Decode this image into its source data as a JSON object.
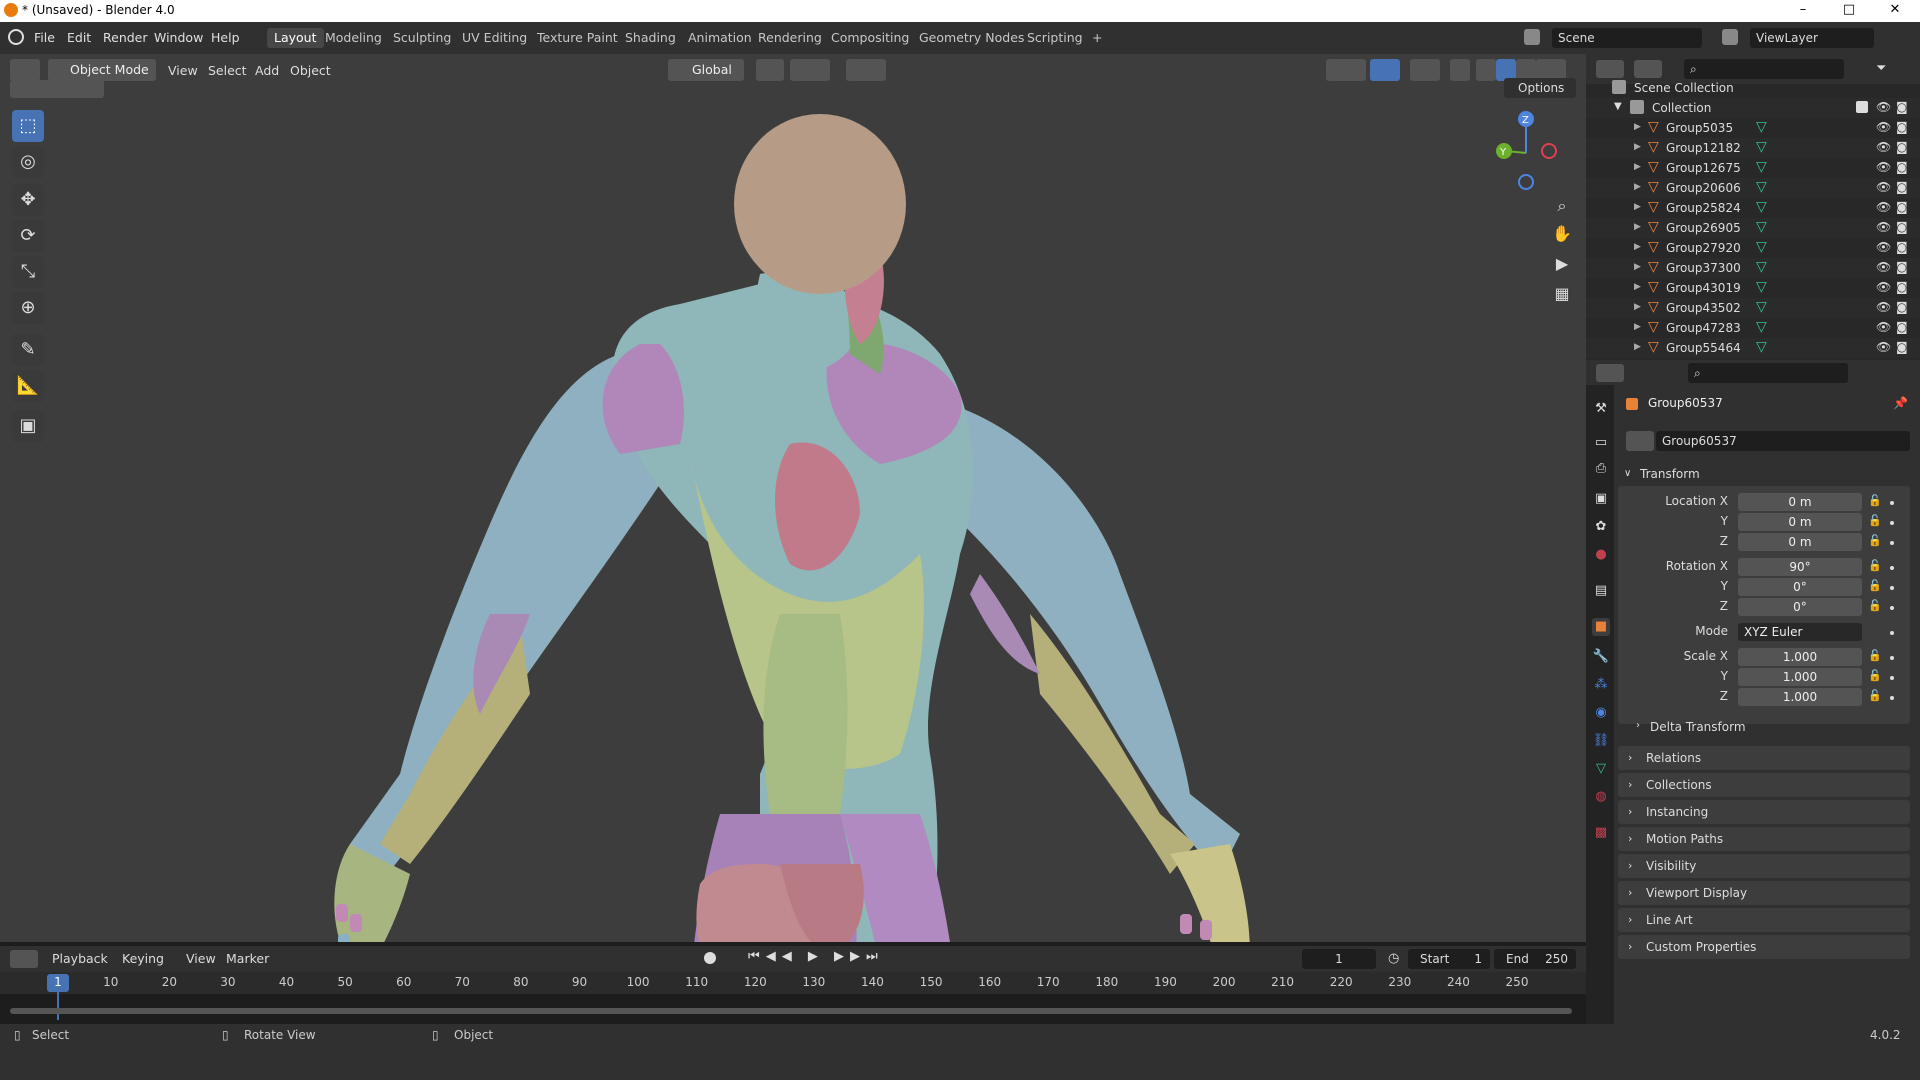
{
  "window": {
    "title": "* (Unsaved) - Blender 4.0",
    "minimize": "–",
    "maximize": "□",
    "close": "✕"
  },
  "menu": {
    "file": "File",
    "edit": "Edit",
    "render": "Render",
    "window": "Window",
    "help": "Help"
  },
  "workspaces": [
    "Layout",
    "Modeling",
    "Sculpting",
    "UV Editing",
    "Texture Paint",
    "Shading",
    "Animation",
    "Rendering",
    "Compositing",
    "Geometry Nodes",
    "Scripting"
  ],
  "add_workspace": "+",
  "scene": {
    "label": "Scene",
    "view_layer": "ViewLayer"
  },
  "viewport_header": {
    "mode": "Object Mode",
    "view": "View",
    "select": "Select",
    "add": "Add",
    "object": "Object",
    "orientation": "Global",
    "options": "Options"
  },
  "gizmo": {
    "z": "Z",
    "y": "Y"
  },
  "timeline": {
    "playback": "Playback",
    "keying": "Keying",
    "view": "View",
    "marker": "Marker",
    "current_frame": "1",
    "start_label": "Start",
    "start": "1",
    "end_label": "End",
    "end": "250",
    "ticks": [
      "1",
      "10",
      "20",
      "30",
      "40",
      "50",
      "60",
      "70",
      "80",
      "90",
      "100",
      "110",
      "120",
      "130",
      "140",
      "150",
      "160",
      "170",
      "180",
      "190",
      "200",
      "210",
      "220",
      "230",
      "240",
      "250"
    ]
  },
  "status": {
    "select": "Select",
    "rotate_view": "Rotate View",
    "object": "Object",
    "version": "4.0.2"
  },
  "outliner": {
    "scene_collection": "Scene Collection",
    "collection": "Collection",
    "items": [
      "Group5035",
      "Group12182",
      "Group12675",
      "Group20606",
      "Group25824",
      "Group26905",
      "Group27920",
      "Group37300",
      "Group43019",
      "Group43502",
      "Group47283",
      "Group55464"
    ]
  },
  "properties": {
    "object_name": "Group60537",
    "object_field": "Group60537",
    "transform": "Transform",
    "location_x_label": "Location X",
    "y_label": "Y",
    "z_label": "Z",
    "location": [
      "0 m",
      "0 m",
      "0 m"
    ],
    "rotation_x_label": "Rotation X",
    "rotation": [
      "90°",
      "0°",
      "0°"
    ],
    "mode_label": "Mode",
    "mode": "XYZ Euler",
    "scale_x_label": "Scale X",
    "scale": [
      "1.000",
      "1.000",
      "1.000"
    ],
    "delta_transform": "Delta Transform",
    "sections": [
      "Relations",
      "Collections",
      "Instancing",
      "Motion Paths",
      "Visibility",
      "Viewport Display",
      "Line Art",
      "Custom Properties"
    ]
  },
  "colors": {
    "accent": "#4772b3",
    "viewport_bg": "#3d3d3d",
    "mesh_icon": "#e8823a"
  }
}
